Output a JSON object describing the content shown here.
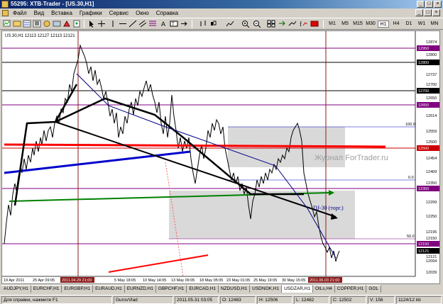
{
  "window": {
    "title": "55295: XTB-Trader - [US.30,H1]",
    "controls": [
      "_",
      "□",
      "×"
    ],
    "mdi_controls": [
      "_",
      "□",
      "×"
    ]
  },
  "menu": {
    "items": [
      "Файл",
      "Вид",
      "Вставка",
      "Графики",
      "Сервис",
      "Окно",
      "Справка"
    ]
  },
  "toolbar": {
    "timeframes": [
      "M1",
      "M5",
      "M15",
      "M30",
      "H1",
      "H4",
      "D1",
      "W1",
      "MN"
    ],
    "active_timeframe": "H1"
  },
  "chart": {
    "info": "US.30,H1  12113 12127 12113 12121",
    "watermark": "Журнал ForTrader.ru",
    "annotation": "DJ-30 (торг.)",
    "price_labels": [
      "12874",
      "12800",
      "12737",
      "12700",
      "12650",
      "12614",
      "12559",
      "12500",
      "12454",
      "12409",
      "12350",
      "12299",
      "12250",
      "12195",
      "12150",
      "12121",
      "12094",
      "12039"
    ],
    "highlighted_prices": [
      "12950",
      "12800",
      "12700",
      "12650",
      "12500",
      "12350",
      "12150",
      "12121"
    ],
    "fib_labels": [
      "100.0",
      "0.0",
      "50.0"
    ],
    "time_labels": [
      "19 Apr 2011",
      "25 Apr 09:05",
      "2011.04.29 21:00",
      "5 May 18:05",
      "10 May 14:05",
      "13 May 09:05",
      "18 May 05:05",
      "23 May 01:05",
      "25 May 19:05",
      "30 May 15:05",
      "2011.06.03 21:00"
    ],
    "colors": {
      "price_line": "#000000",
      "level_purple": "#800080",
      "level_red": "#cc0000",
      "channel_red": "#ff0000",
      "channel_blue": "#0000cc",
      "channel_green": "#008000",
      "fib_box": "#d9d9d9",
      "navy": "#000080"
    }
  },
  "symbol_tabs": [
    "AUDJPY,H1",
    "EURCHF,H1",
    "EURGBP,H1",
    "EURAUD,H1",
    "EURNZD,H1",
    "GBPCHF,H1",
    "EURCAD,H1",
    "NZDUSD,H1",
    "USDNOK,H1",
    "USDZAR,H1",
    "OILs,H4",
    "COPPER,H1",
    "GOL"
  ],
  "active_symbol_tab": "USDZAR,H1",
  "status": {
    "help": "Для справки, нажмите F1",
    "profile": "GurovVlad",
    "datetime": "2011.05.31 03:05",
    "open": "O: 12483",
    "high": "H: 12506",
    "low": "L: 12482",
    "close": "C: 12502",
    "volume": "V: 156",
    "traffic": "1124/12 kb"
  }
}
